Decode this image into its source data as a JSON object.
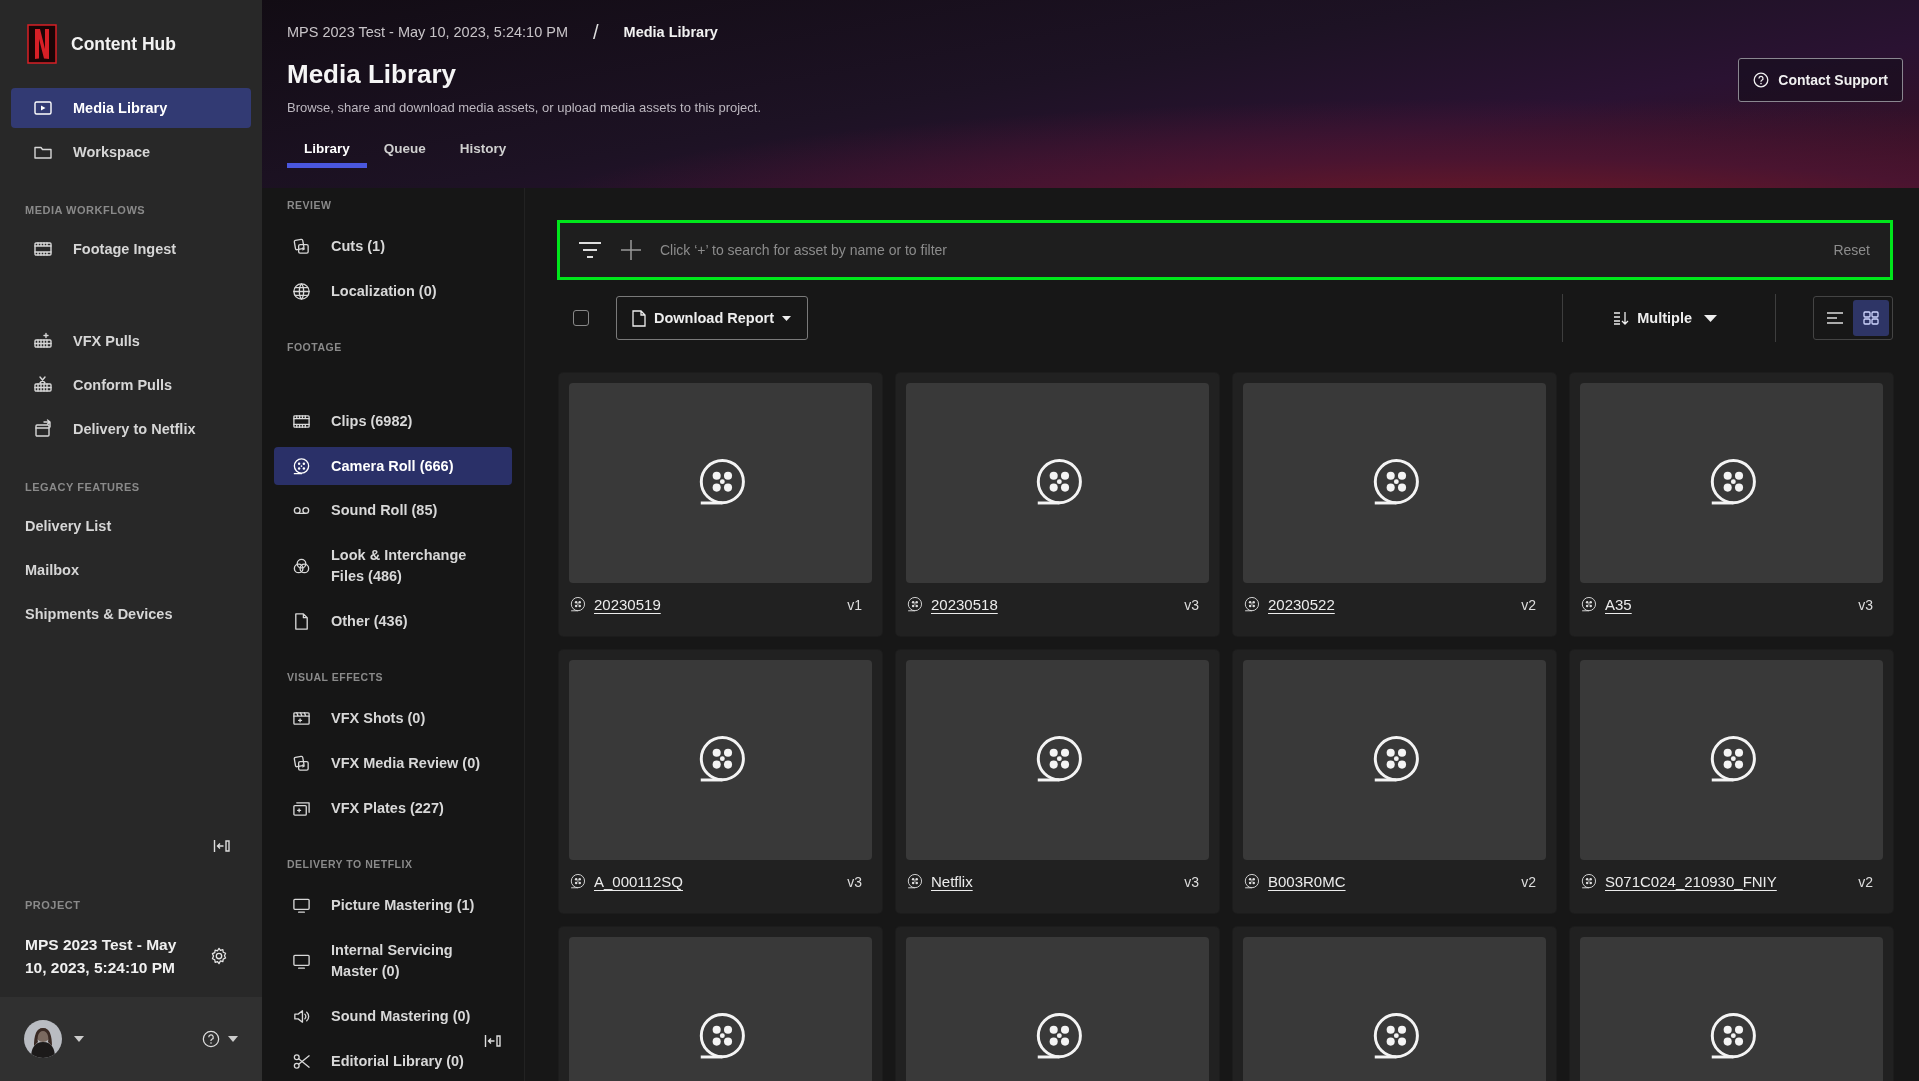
{
  "sidebar": {
    "app_name": "Content Hub",
    "items": [
      {
        "label": "Media Library",
        "selected": true
      },
      {
        "label": "Workspace",
        "selected": false
      }
    ],
    "sections": [
      {
        "title": "MEDIA WORKFLOWS",
        "items": [
          {
            "label": "Footage Ingest",
            "selected": false
          },
          {
            "label": "VFX Pulls",
            "selected": false
          },
          {
            "label": "Conform Pulls",
            "selected": false
          },
          {
            "label": "Delivery to Netflix",
            "selected": false
          }
        ]
      },
      {
        "title": "LEGACY FEATURES",
        "items": [
          {
            "label": "Delivery List",
            "selected": false
          },
          {
            "label": "Mailbox",
            "selected": false
          },
          {
            "label": "Shipments & Devices",
            "selected": false
          }
        ]
      }
    ],
    "project": {
      "label": "PROJECT",
      "name": "MPS 2023 Test - May 10, 2023, 5:24:10 PM"
    }
  },
  "header": {
    "breadcrumb": [
      "MPS 2023 Test - May 10, 2023, 5:24:10 PM",
      "Media Library"
    ],
    "separator": "/",
    "title": "Media Library",
    "description": "Browse, share and download media assets, or upload media assets to this project.",
    "tabs": [
      {
        "label": "Library",
        "selected": true
      },
      {
        "label": "Queue",
        "selected": false
      },
      {
        "label": "History",
        "selected": false
      }
    ],
    "contact_button": "Contact Support"
  },
  "library_nav": {
    "sections": [
      {
        "title": "REVIEW",
        "items": [
          {
            "label": "Cuts (1)",
            "selected": false
          },
          {
            "label": "Localization (0)",
            "selected": false
          }
        ]
      },
      {
        "title": "FOOTAGE",
        "items": [
          {
            "label": "Clips (6982)",
            "selected": false
          },
          {
            "label": "Camera Roll (666)",
            "selected": true
          },
          {
            "label": "Sound Roll (85)",
            "selected": false
          },
          {
            "label": "Look & Interchange Files (486)",
            "selected": false
          },
          {
            "label": "Other (436)",
            "selected": false
          }
        ]
      },
      {
        "title": "VISUAL EFFECTS",
        "items": [
          {
            "label": "VFX Shots (0)",
            "selected": false
          },
          {
            "label": "VFX Media Review (0)",
            "selected": false
          },
          {
            "label": "VFX Plates (227)",
            "selected": false
          }
        ]
      },
      {
        "title": "DELIVERY TO NETFLIX",
        "items": [
          {
            "label": "Picture Mastering (1)",
            "selected": false
          },
          {
            "label": "Internal Servicing Master (0)",
            "selected": false
          },
          {
            "label": "Sound Mastering (0)",
            "selected": false
          },
          {
            "label": "Editorial Library (0)",
            "selected": false
          }
        ]
      }
    ]
  },
  "filter_bar": {
    "placeholder": "Click ‘+’ to search for asset by name or to filter",
    "reset": "Reset"
  },
  "toolbar": {
    "select_all_checked": false,
    "download_button": "Download Report",
    "sort_label": "Multiple",
    "views": [
      {
        "kind": "list",
        "selected": false
      },
      {
        "kind": "grid",
        "selected": true
      }
    ]
  },
  "assets": [
    {
      "kind": "full",
      "name": "20230519",
      "version": "v1"
    },
    {
      "kind": "full",
      "name": "20230518",
      "version": "v3"
    },
    {
      "kind": "full",
      "name": "20230522",
      "version": "v2"
    },
    {
      "kind": "full",
      "name": "A35",
      "version": "v3"
    },
    {
      "kind": "full",
      "name": "A_000112SQ",
      "version": "v3"
    },
    {
      "kind": "full",
      "name": "Netflix",
      "version": "v3"
    },
    {
      "kind": "full",
      "name": "B003R0MC",
      "version": "v2"
    },
    {
      "kind": "full",
      "name": "S071C024_210930_FNIY",
      "version": "v2"
    },
    {
      "kind": "partial"
    },
    {
      "kind": "partial"
    },
    {
      "kind": "partial"
    },
    {
      "kind": "partial"
    }
  ]
}
